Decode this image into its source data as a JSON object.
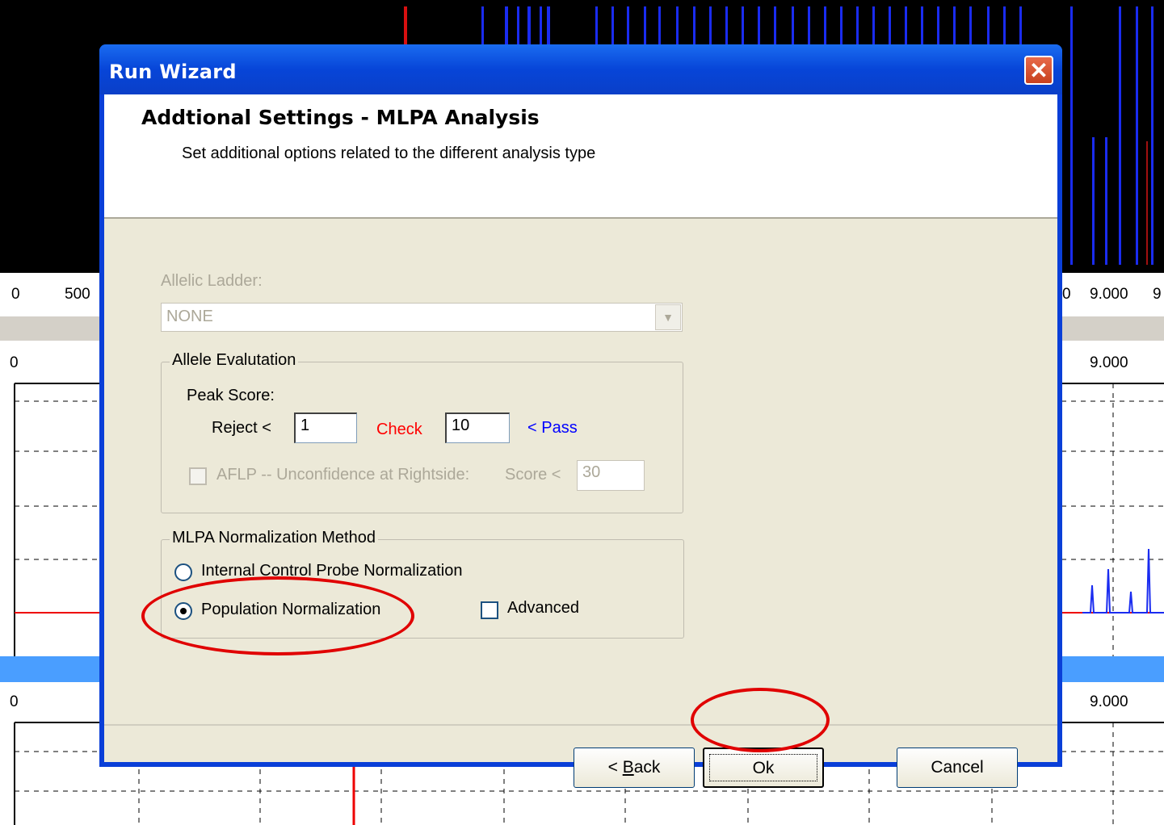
{
  "background": {
    "ruler_labels": [
      "0",
      "500",
      "0",
      "9.000",
      "9"
    ],
    "panel1_labels": [
      "0",
      "9.000"
    ],
    "panel2_labels": [
      "0",
      "9.000"
    ]
  },
  "dialog": {
    "title": "Run Wizard",
    "close_glyph": "✕",
    "header_title": "Addtional Settings - MLPA Analysis",
    "header_subtitle": "Set additional options related to the different analysis type",
    "allelic_ladder_label": "Allelic Ladder:",
    "allelic_ladder_value": "NONE",
    "allele_eval": {
      "legend": "Allele Evalutation",
      "peak_score_label": "Peak Score:",
      "reject_label": "Reject  <",
      "reject_value": "1",
      "check_label": "Check",
      "check_value": "10",
      "pass_label": "< Pass",
      "aflp_label": "AFLP -- Unconfidence at Rightside:",
      "score_label": "Score <",
      "score_value": "30"
    },
    "mlpa": {
      "legend": "MLPA Normalization Method",
      "option1": "Internal Control Probe Normalization",
      "option2": "Population Normalization",
      "selected": "Population Normalization",
      "advanced_label": "Advanced"
    },
    "buttons": {
      "back_prefix": "< ",
      "back_mnemonic": "B",
      "back_rest": "ack",
      "ok": "Ok",
      "cancel": "Cancel"
    }
  },
  "colors": {
    "titlebar": "#0745d8",
    "annotation": "#e00000",
    "check_text": "#ff0000",
    "pass_text": "#0000ff"
  }
}
